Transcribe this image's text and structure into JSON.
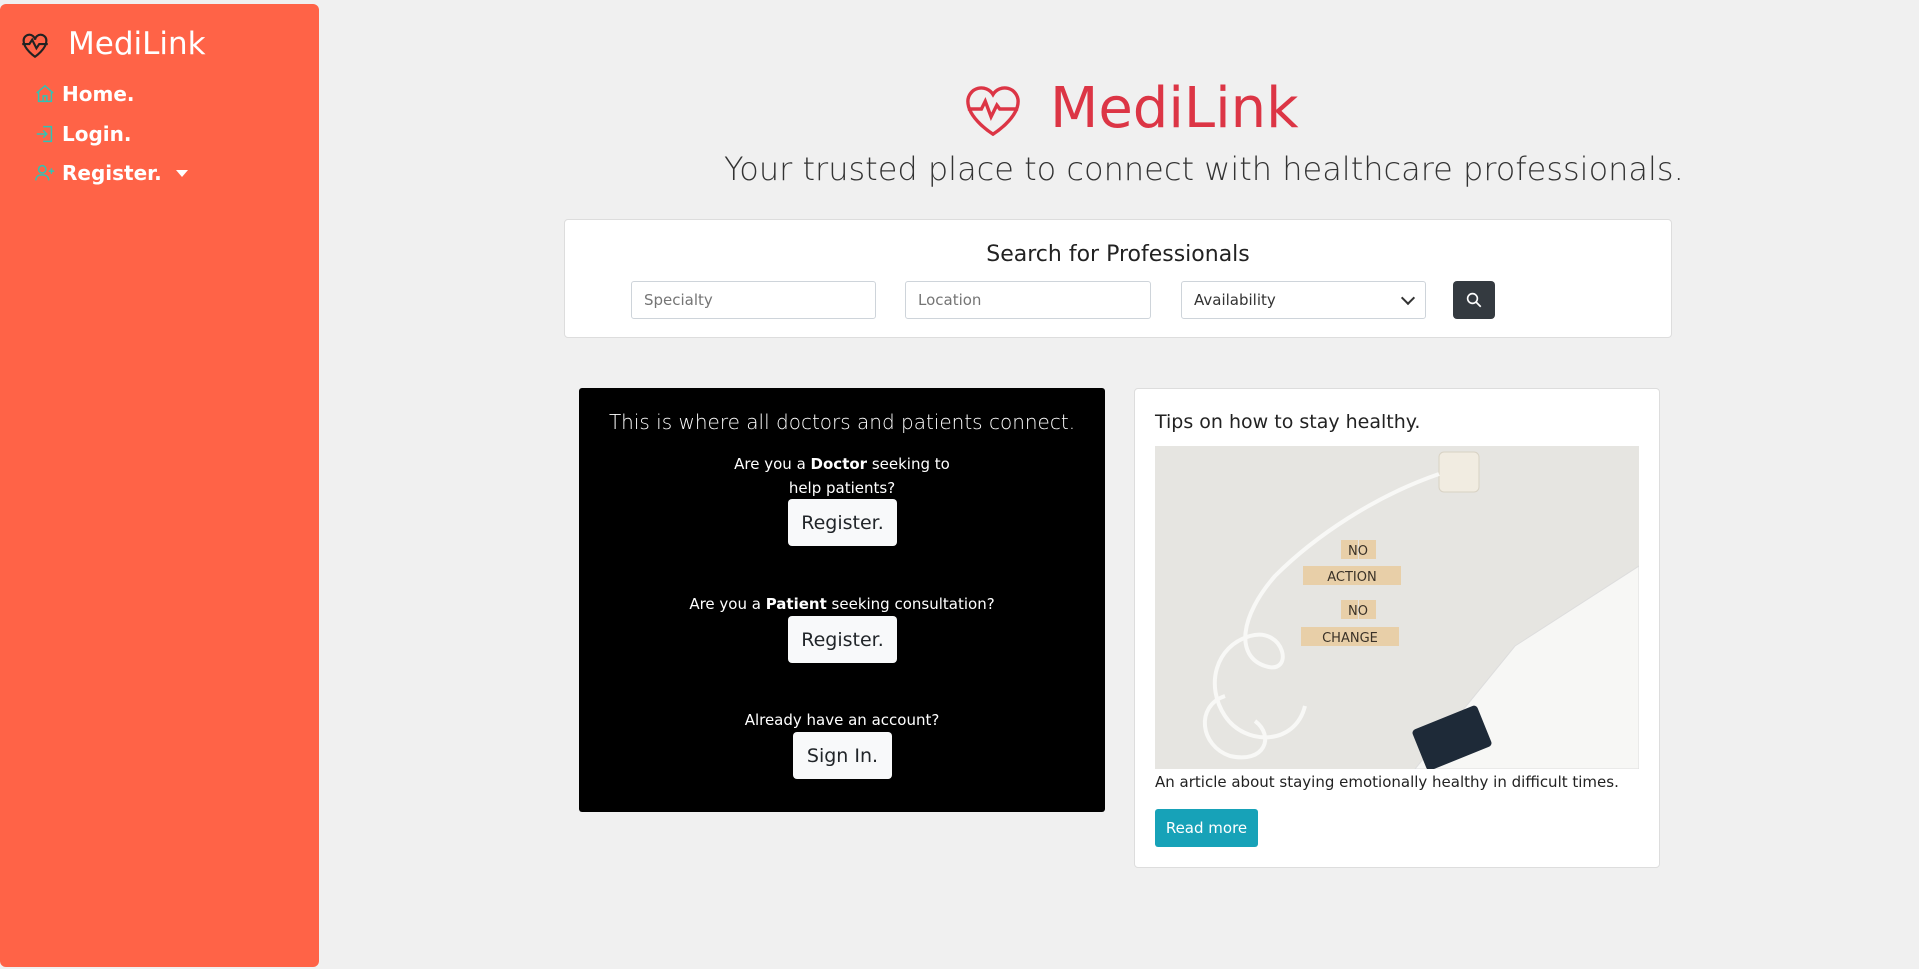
{
  "sidebar": {
    "brand": "MediLink",
    "items": [
      {
        "label": "Home.",
        "icon": "home-icon"
      },
      {
        "label": "Login.",
        "icon": "login-icon"
      },
      {
        "label": "Register.",
        "icon": "user-plus-icon"
      }
    ]
  },
  "hero": {
    "title": "MediLink",
    "subtitle": "Your trusted place to connect with healthcare professionals."
  },
  "search": {
    "title": "Search for Professionals",
    "specialty_placeholder": "Specialty",
    "location_placeholder": "Location",
    "availability_value": "Availability"
  },
  "connect": {
    "title": "This is where all doctors and patients connect.",
    "doctor_prefix": "Are you a ",
    "doctor_strong": "Doctor",
    "doctor_suffix": " seeking to help patients?",
    "doctor_button": "Register.",
    "patient_prefix": "Are you a ",
    "patient_strong": "Patient",
    "patient_suffix": " seeking consultation?",
    "patient_button": "Register.",
    "account_text": "Already have an account?",
    "signin_button": "Sign In."
  },
  "tips": {
    "title": "Tips on how to stay healthy.",
    "image_tiles": [
      "NO",
      "ACTION",
      "NO",
      "CHANGE"
    ],
    "description": "An article about staying emotionally healthy in difficult times.",
    "button": "Read more"
  },
  "colors": {
    "sidebar": "#ff6347",
    "brand_red": "#dc3545",
    "info": "#17a2b8",
    "dark": "#343a40"
  }
}
